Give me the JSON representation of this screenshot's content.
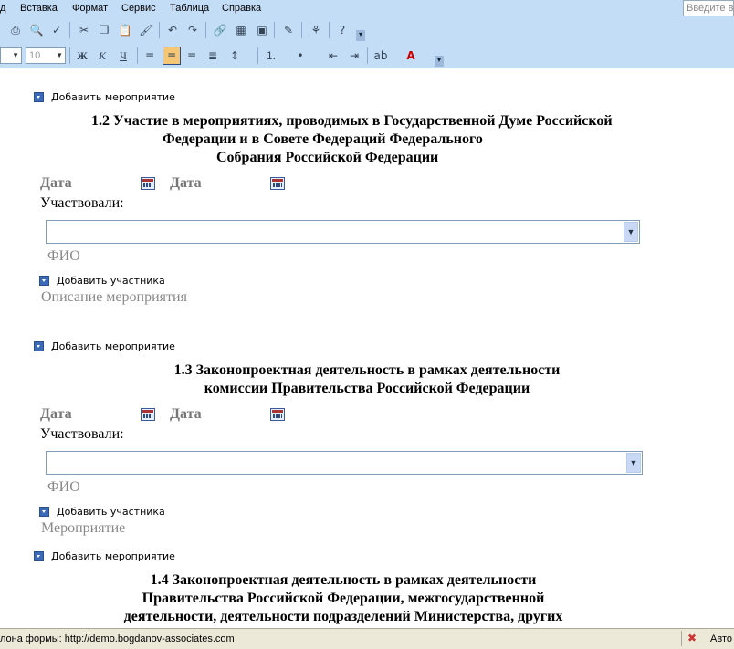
{
  "menu": {
    "items": [
      "д",
      "Вставка",
      "Формат",
      "Сервис",
      "Таблица",
      "Справка"
    ],
    "help_placeholder": "Введите во"
  },
  "toolbar2": {
    "font_size": "10"
  },
  "sections": [
    {
      "add_event": "Добавить мероприятие",
      "heading_lines": [
        "1.2 Участие в мероприятиях, проводимых в Государственной Думе Российской",
        "Федерации и в Совете Федераций Федерального",
        "Собрания Российской Федерации"
      ],
      "date1": "Дата",
      "date2": "Дата",
      "participated": "Участвовали:",
      "fio": "ФИО",
      "add_participant": "Добавить участника",
      "description": "Описание мероприятия"
    },
    {
      "add_event": "Добавить мероприятие",
      "heading_lines": [
        "1.3 Законопроектная деятельность в рамках деятельности",
        "комиссии Правительства Российской Федерации"
      ],
      "date1": "Дата",
      "date2": "Дата",
      "participated": "Участвовали:",
      "fio": "ФИО",
      "add_participant": "Добавить участника",
      "description": "Мероприятие"
    },
    {
      "add_event": "Добавить мероприятие",
      "heading_lines": [
        "1.4 Законопроектная деятельность в рамках деятельности",
        "Правительства Российской Федерации, межгосударственной",
        "деятельности, деятельности подразделений Министерства, других"
      ]
    }
  ],
  "status": {
    "text": "лона формы: http://demo.bogdanov-associates.com",
    "right": "Авто"
  }
}
